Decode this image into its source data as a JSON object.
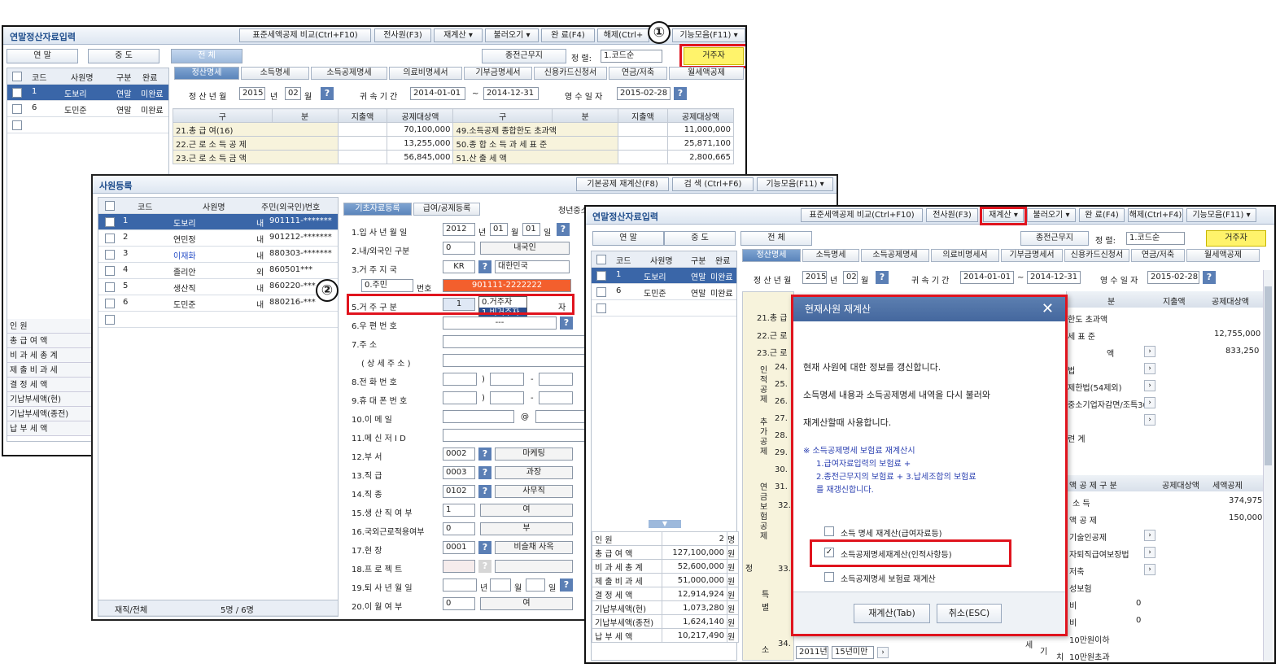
{
  "win1": {
    "title": "연말정산자료입력",
    "toolbar": [
      "표준세액공제 비교(Ctrl+F10)",
      "전사원(F3)",
      "재계산 ▾",
      "불러오기 ▾",
      "완 료(F4)",
      "해제(Ctrl+",
      "기능모음(F11) ▾"
    ],
    "filters": [
      "연 말",
      "중 도",
      "전 체"
    ],
    "prev_work": "종전근무지",
    "sort_label": "정 렬:",
    "sort_value": "1.코드순",
    "resident_btn": "거주자",
    "tabs": [
      "정산명세",
      "소득명세",
      "소득공제명세",
      "의료비명세서",
      "기부금명세서",
      "신용카드신청서",
      "연금/저축",
      "월세액공제"
    ],
    "year_label": "정 산 년 월",
    "year": "2015",
    "year_unit": "년",
    "month": "02",
    "month_unit": "월",
    "period_label": "귀 속 기 간",
    "period_from": "2014-01-01",
    "period_to": "2014-12-31",
    "receipt_label": "영 수 일 자",
    "receipt_date": "2015-02-28",
    "list_headers": [
      "코드",
      "사원명",
      "구분",
      "완료"
    ],
    "employees": [
      {
        "code": "1",
        "name": "도보리",
        "type": "연말",
        "done": "미완료"
      },
      {
        "code": "6",
        "name": "도민준",
        "type": "연말",
        "done": "미완료"
      }
    ],
    "grid_headers": [
      "구",
      "분",
      "지출액",
      "공제대상액",
      "구",
      "분",
      "지출액",
      "공제대상액"
    ],
    "rows": [
      {
        "l": "21.총 급 여(16)",
        "la": "70,100,000",
        "r": "49.소득공제 종합한도 초과액",
        "ra": "11,000,000"
      },
      {
        "l": "22.근 로 소 득 공 제",
        "la": "13,255,000",
        "r": "50.종 합 소 득 과 세 표 준",
        "ra": "25,871,100"
      },
      {
        "l": "23.근 로 소 득 금 액",
        "la": "56,845,000",
        "r": "51.산 출 세 액",
        "ra": "2,800,665"
      }
    ],
    "sum_labels": [
      "인 원",
      "총 급 여 액",
      "비 과 세 총 계",
      "제 출 비 과 세",
      "결 정 세 액",
      "기납부세액(현)",
      "기납부세액(종전)",
      "납 부 세 액"
    ]
  },
  "win2": {
    "title": "사원등록",
    "toolbar": [
      "기본공제 재계산(F8)",
      "검 색 (Ctrl+F6)",
      "기능모음(F11) ▾"
    ],
    "list_headers": [
      "코드",
      "사원명",
      "주민(외국인)번호"
    ],
    "employees": [
      {
        "code": "1",
        "name": "도보리",
        "kind": "내",
        "id": "901111-*******"
      },
      {
        "code": "2",
        "name": "연민정",
        "kind": "내",
        "id": "901212-*******"
      },
      {
        "code": "3",
        "name": "이재화",
        "kind": "내",
        "id": "880303-*******"
      },
      {
        "code": "4",
        "name": "졸리안",
        "kind": "외",
        "id": "860501***"
      },
      {
        "code": "5",
        "name": "생산직",
        "kind": "내",
        "id": "860220-***"
      },
      {
        "code": "6",
        "name": "도민준",
        "kind": "내",
        "id": "880216-***"
      }
    ],
    "footer_label": "재직/전체",
    "footer_value": "5명 / 6명",
    "tabs": [
      "기초자료등록",
      "급여/공제등록"
    ],
    "youth_label": "청년중소",
    "fields": {
      "f1": "1.입 사 년 월 일",
      "f1_y": "2012",
      "f1_yu": "년",
      "f1_m": "01",
      "f1_mu": "월",
      "f1_d": "01",
      "f1_du": "일",
      "f2": "2.내/외국인 구분",
      "f2_v": "0",
      "f2_t": "내국인",
      "f3": "3.거 주 지 국",
      "f3_v": "KR",
      "f3_t": "대한민국",
      "f4_sel": "0.주민",
      "f4_l": "번호",
      "f4_v": "901111-2222222",
      "f5": "5.거 주 구 분",
      "f5_v": "1",
      "f5_opt1": "0.거주자",
      "f5_opt2": "1.비거주자",
      "f5_tail": "자",
      "f6": "6.우 편 번 호",
      "f6_v": "---",
      "f7": "7.주 소",
      "f7b": "( 상 세 주 소 )",
      "f8": "8.전 화 번 호",
      "f9": "9.휴 대 폰 번 호",
      "paren": ")",
      "dash": "-",
      "f10": "10.이 메 일",
      "at": "@",
      "f11": "11.메 신 저 I D",
      "f12": "12.부 서",
      "f12_v": "0002",
      "f12_t": "마케팅",
      "f13": "13.직 급",
      "f13_v": "0003",
      "f13_t": "과장",
      "f14": "14.직 종",
      "f14_v": "0102",
      "f14_t": "사무직",
      "f15": "15.생 산 직 여 부",
      "f15_v": "1",
      "f15_t": "여",
      "f16": "16.국외근로적용여부",
      "f16_v": "0",
      "f16_t": "부",
      "f17": "17.현 장",
      "f17_v": "0001",
      "f17_t": "비슬채 사옥",
      "f18": "18.프 로 젝 트",
      "f19": "19.퇴 사 년 월 일",
      "f19_yu": "년",
      "f19_mu": "월",
      "f19_du": "일",
      "f20": "20.이 월 여 부",
      "f20_v": "0",
      "f20_t": "여"
    }
  },
  "win3": {
    "title": "연말정산자료입력",
    "toolbar": [
      "표준세액공제 비교(Ctrl+F10)",
      "전사원(F3)",
      "재계산 ▾",
      "불러오기 ▾",
      "완 료(F4)",
      "해제(Ctrl+F4)",
      "기능모음(F11) ▾"
    ],
    "filters": [
      "연 말",
      "중 도",
      "전 체"
    ],
    "prev_work": "종전근무지",
    "sort_label": "정 렬:",
    "sort_value": "1.코드순",
    "resident_btn": "거주자",
    "tabs": [
      "정산명세",
      "소득명세",
      "소득공제명세",
      "의료비명세서",
      "기부금명세서",
      "신용카드신청서",
      "연금/저축",
      "월세액공제"
    ],
    "year_label": "정 산 년 월",
    "year": "2015",
    "year_unit": "년",
    "month": "02",
    "month_unit": "월",
    "period_label": "귀 속 기 간",
    "period_from": "2014-01-01",
    "period_to": "2014-12-31",
    "receipt_label": "영 수 일 자",
    "receipt_date": "2015-02-28",
    "list_headers": [
      "코드",
      "사원명",
      "구분",
      "완료"
    ],
    "employees": [
      {
        "code": "1",
        "name": "도보리",
        "type": "연말",
        "done": "미완료"
      },
      {
        "code": "6",
        "name": "도민준",
        "type": "연말",
        "done": "미완료"
      }
    ],
    "sums": [
      {
        "l": "인 원",
        "v": "2",
        "u": "명"
      },
      {
        "l": "총 급 여 액",
        "v": "127,100,000",
        "u": "원"
      },
      {
        "l": "비 과 세 총 계",
        "v": "52,600,000",
        "u": "원"
      },
      {
        "l": "제 출 비 과 세",
        "v": "51,000,000",
        "u": "원"
      },
      {
        "l": "결 정 세 액",
        "v": "12,914,924",
        "u": "원"
      },
      {
        "l": "기납부세액(현)",
        "v": "1,073,280",
        "u": "원"
      },
      {
        "l": "기납부세액(종전)",
        "v": "1,624,140",
        "u": "원"
      },
      {
        "l": "납 부 세 액",
        "v": "10,217,490",
        "u": "원"
      }
    ],
    "right_hdr": [
      "구",
      "분",
      "지출액",
      "공제대상액"
    ],
    "right_rows": [
      "한도 초과액",
      "세 표 준",
      "액",
      "법",
      "제한법(54제외)",
      "중소기업자감면/조특30",
      "",
      "",
      "련 계",
      "",
      "",
      ""
    ],
    "right_amts": [
      "",
      "12,755,000",
      "833,250"
    ],
    "tax_hdr": [
      "액 공 제 구 분",
      "공제대상액",
      "세액공제"
    ],
    "tax_rows": [
      {
        "l": "소 득",
        "v": "374,975"
      },
      {
        "l": "액 공 제",
        "v": "150,000"
      },
      {
        "l": "기술인공제",
        "v": ""
      },
      {
        "l": "자퇴직급여보장법",
        "v": ""
      },
      {
        "l": "저축",
        "v": ""
      },
      {
        "l": "성보험",
        "v": ""
      },
      {
        "l": "비",
        "v": "0"
      },
      {
        "l": "비",
        "v": "0"
      },
      {
        "l": "10만원이하",
        "v": ""
      },
      {
        "l": "10만원초과",
        "v": ""
      }
    ],
    "left_labels": [
      "21.총 급",
      "22.근 로",
      "23.근 로",
      "24.",
      "25.",
      "26.",
      "27.",
      "28.",
      "29.",
      "30.",
      "31.",
      "32.",
      "33."
    ],
    "vert_labels": [
      "인적공제",
      "추가공제",
      "연금보험공제",
      "특별",
      "소"
    ],
    "vert_main": "정",
    "bottom_l1": "34.",
    "bottom_l2": "2011년이",
    "bottom_l3": "15년미만",
    "bottom_tax_l": "세",
    "bottom_tax_l2": "기",
    "bottom_tax_l3": "치"
  },
  "dialog": {
    "title": "현재사원 재계산",
    "line1": "현재 사원에 대한 정보를 갱신합니다.",
    "line2": "소득명세 내용과 소득공제명세 내역을 다시 불러와",
    "line3": "재계산할때 사용합니다.",
    "note1": "※ 소득공제명세 보험료 재계산시",
    "note2": "1.급여자료입력의 보험료 +",
    "note3": "2.종전근무지의 보험료 + 3.납세조합의 보험료",
    "note4": "를 재갱신합니다.",
    "opt1": "소득 명세 재계산(급여자료등)",
    "opt2": "소득공제명세재계산(인적사항등)",
    "opt3": "소득공제명세 보험료 재계산",
    "ok": "재계산(Tab)",
    "cancel": "취소(ESC)"
  },
  "markers": {
    "one": "①",
    "two": "②"
  }
}
